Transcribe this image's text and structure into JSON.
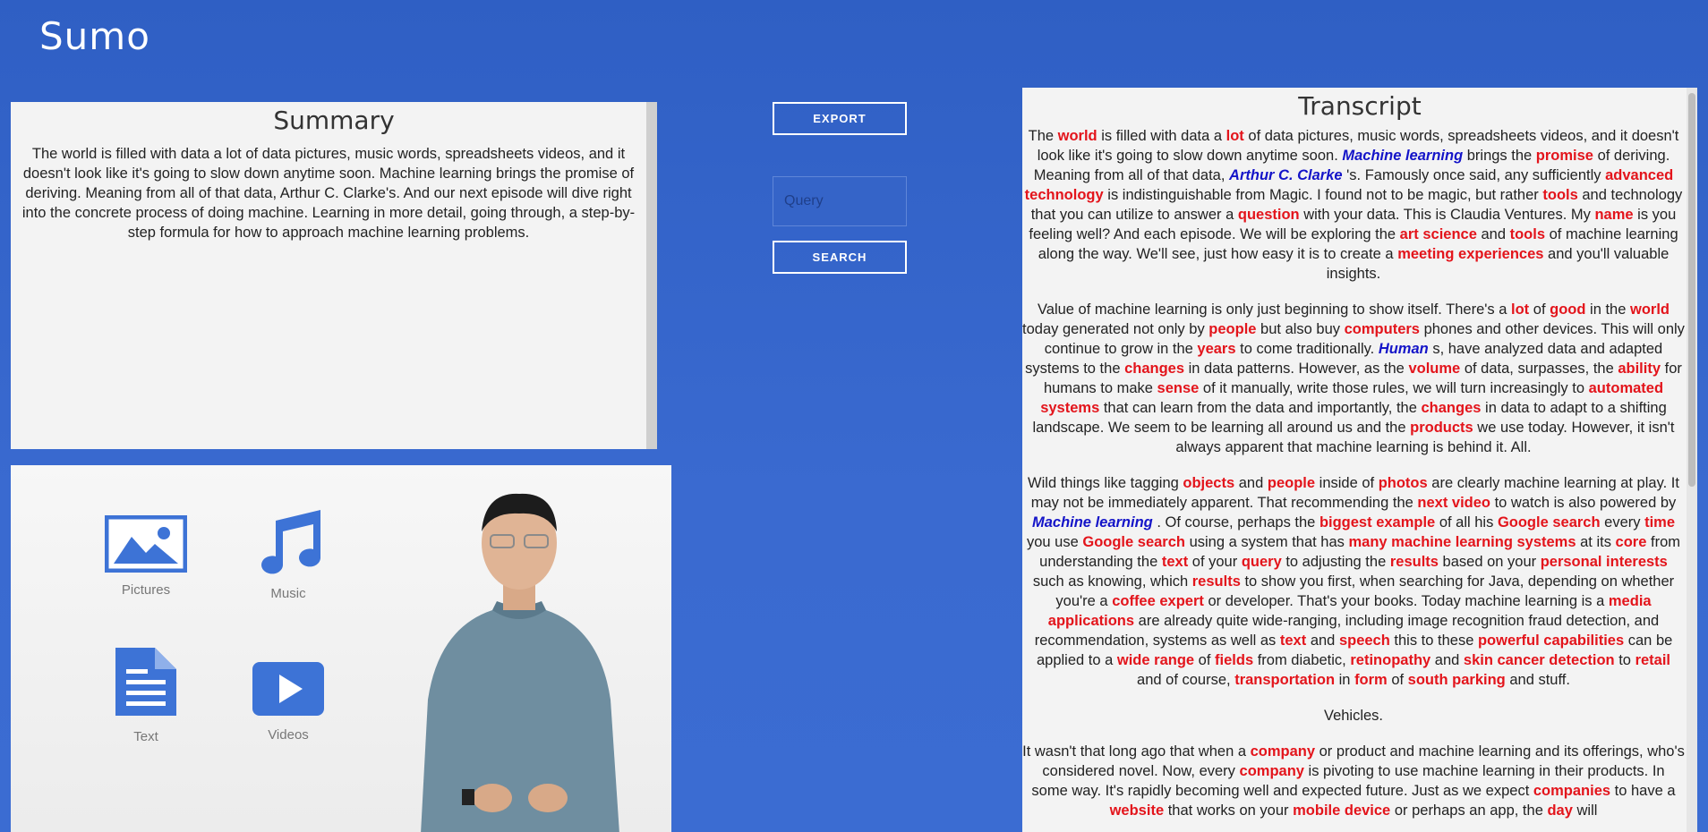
{
  "app": {
    "title": "Sumo"
  },
  "summary": {
    "title": "Summary",
    "text": "The world is filled with data a lot of data pictures, music words, spreadsheets videos, and it doesn't look like it's going to slow down anytime soon. Machine learning brings the promise of deriving. Meaning from all of that data, Arthur C. Clarke's. And our next episode will dive right into the concrete process of doing machine. Learning in more detail, going through, a step-by-step formula for how to approach machine learning problems."
  },
  "controls": {
    "export_label": "EXPORT",
    "query_placeholder": "Query",
    "search_label": "SEARCH"
  },
  "video": {
    "items": [
      {
        "label": "Pictures",
        "icon": "picture-icon"
      },
      {
        "label": "Music",
        "icon": "music-note-icon"
      },
      {
        "label": "Text",
        "icon": "document-icon"
      },
      {
        "label": "Videos",
        "icon": "play-icon"
      }
    ]
  },
  "transcript": {
    "title": "Transcript",
    "paragraphs": [
      [
        [
          "t",
          "The "
        ],
        [
          "k",
          "world"
        ],
        [
          "t",
          " is filled with data a "
        ],
        [
          "k",
          "lot"
        ],
        [
          "t",
          " of data pictures, music words, spreadsheets videos, and it doesn't look like it's going to slow down anytime soon. "
        ],
        [
          "e",
          "Machine learning"
        ],
        [
          "t",
          " brings the "
        ],
        [
          "k",
          "promise"
        ],
        [
          "t",
          " of deriving. Meaning from all of that data, "
        ],
        [
          "e",
          "Arthur C. Clarke"
        ],
        [
          "t",
          " 's. Famously once said, any sufficiently "
        ],
        [
          "k",
          "advanced technology"
        ],
        [
          "t",
          " is indistinguishable from Magic. I found not to be magic, but rather "
        ],
        [
          "k",
          "tools"
        ],
        [
          "t",
          " and technology that you can utilize to answer a "
        ],
        [
          "k",
          "question"
        ],
        [
          "t",
          " with your data. This is Claudia Ventures. My "
        ],
        [
          "k",
          "name"
        ],
        [
          "t",
          " is you feeling well? And each episode. We will be exploring the "
        ],
        [
          "k",
          "art science"
        ],
        [
          "t",
          " and "
        ],
        [
          "k",
          "tools"
        ],
        [
          "t",
          " of machine learning along the way. We'll see, just how easy it is to create a "
        ],
        [
          "k",
          "meeting experiences"
        ],
        [
          "t",
          " and you'll valuable insights."
        ]
      ],
      [
        [
          "t",
          "Value of machine learning is only just beginning to show itself. There's a "
        ],
        [
          "k",
          "lot"
        ],
        [
          "t",
          " of "
        ],
        [
          "k",
          "good"
        ],
        [
          "t",
          " in the "
        ],
        [
          "k",
          "world"
        ],
        [
          "t",
          " today generated not only by "
        ],
        [
          "k",
          "people"
        ],
        [
          "t",
          " but also buy "
        ],
        [
          "k",
          "computers"
        ],
        [
          "t",
          " phones and other devices. This will only continue to grow in the "
        ],
        [
          "k",
          "years"
        ],
        [
          "t",
          " to come traditionally. "
        ],
        [
          "e",
          "Human"
        ],
        [
          "t",
          " s, have analyzed data and adapted systems to the "
        ],
        [
          "k",
          "changes"
        ],
        [
          "t",
          " in data patterns. However, as the "
        ],
        [
          "k",
          "volume"
        ],
        [
          "t",
          " of data, surpasses, the "
        ],
        [
          "k",
          "ability"
        ],
        [
          "t",
          " for humans to make "
        ],
        [
          "k",
          "sense"
        ],
        [
          "t",
          " of it manually, write those rules, we will turn increasingly to "
        ],
        [
          "k",
          "automated systems"
        ],
        [
          "t",
          " that can learn from the data and importantly, the "
        ],
        [
          "k",
          "changes"
        ],
        [
          "t",
          " in data to adapt to a shifting landscape. We seem to be learning all around us and the "
        ],
        [
          "k",
          "products"
        ],
        [
          "t",
          " we use today. However, it isn't always apparent that machine learning is behind it. All."
        ]
      ],
      [
        [
          "t",
          "Wild things like tagging "
        ],
        [
          "k",
          "objects"
        ],
        [
          "t",
          " and "
        ],
        [
          "k",
          "people"
        ],
        [
          "t",
          " inside of "
        ],
        [
          "k",
          "photos"
        ],
        [
          "t",
          " are clearly machine learning at play. It may not be immediately apparent. That recommending the "
        ],
        [
          "k",
          "next video"
        ],
        [
          "t",
          " to watch is also powered by "
        ],
        [
          "e",
          "Machine learning"
        ],
        [
          "t",
          " . Of course, perhaps the "
        ],
        [
          "k",
          "biggest example"
        ],
        [
          "t",
          " of all his "
        ],
        [
          "k",
          "Google search"
        ],
        [
          "t",
          " every "
        ],
        [
          "k",
          "time"
        ],
        [
          "t",
          " you use "
        ],
        [
          "k",
          "Google search"
        ],
        [
          "t",
          " using a system that has "
        ],
        [
          "k",
          "many machine learning systems"
        ],
        [
          "t",
          " at its "
        ],
        [
          "k",
          "core"
        ],
        [
          "t",
          " from understanding the "
        ],
        [
          "k",
          "text"
        ],
        [
          "t",
          " of your "
        ],
        [
          "k",
          "query"
        ],
        [
          "t",
          " to adjusting the "
        ],
        [
          "k",
          "results"
        ],
        [
          "t",
          " based on your "
        ],
        [
          "k",
          "personal interests"
        ],
        [
          "t",
          " such as knowing, which "
        ],
        [
          "k",
          "results"
        ],
        [
          "t",
          " to show you first, when searching for Java, depending on whether you're a "
        ],
        [
          "k",
          "coffee expert"
        ],
        [
          "t",
          " or developer. That's your books. Today machine learning is a "
        ],
        [
          "k",
          "media applications"
        ],
        [
          "t",
          " are already quite wide-ranging, including image recognition fraud detection, and recommendation, systems as well as "
        ],
        [
          "k",
          "text"
        ],
        [
          "t",
          " and "
        ],
        [
          "k",
          "speech"
        ],
        [
          "t",
          " this to these "
        ],
        [
          "k",
          "powerful capabilities"
        ],
        [
          "t",
          " can be applied to a "
        ],
        [
          "k",
          "wide range"
        ],
        [
          "t",
          " of "
        ],
        [
          "k",
          "fields"
        ],
        [
          "t",
          " from diabetic, "
        ],
        [
          "k",
          "retinopathy"
        ],
        [
          "t",
          " and "
        ],
        [
          "k",
          "skin cancer detection"
        ],
        [
          "t",
          " to "
        ],
        [
          "k",
          "retail"
        ],
        [
          "t",
          " and of course, "
        ],
        [
          "k",
          "transportation"
        ],
        [
          "t",
          " in "
        ],
        [
          "k",
          "form"
        ],
        [
          "t",
          " of "
        ],
        [
          "k",
          "south parking"
        ],
        [
          "t",
          " and stuff."
        ]
      ],
      [
        [
          "t",
          "Vehicles."
        ]
      ],
      [
        [
          "t",
          "It wasn't that long ago that when a "
        ],
        [
          "k",
          "company"
        ],
        [
          "t",
          " or product and machine learning and its offerings, who's considered novel. Now, every "
        ],
        [
          "k",
          "company"
        ],
        [
          "t",
          " is pivoting to use machine learning in their products. In some way. It's rapidly becoming well and expected future. Just as we expect "
        ],
        [
          "k",
          "companies"
        ],
        [
          "t",
          " to have a "
        ],
        [
          "k",
          "website"
        ],
        [
          "t",
          " that works on your "
        ],
        [
          "k",
          "mobile device"
        ],
        [
          "t",
          " or perhaps an app, the "
        ],
        [
          "k",
          "day"
        ],
        [
          "t",
          " will"
        ]
      ]
    ]
  }
}
